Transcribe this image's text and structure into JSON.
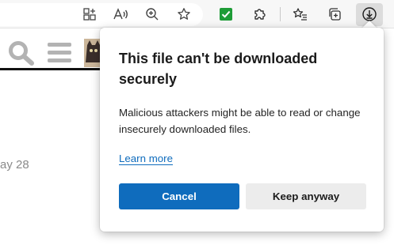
{
  "toolbar": {
    "icons": [
      "app-grid-icon",
      "read-aloud-icon",
      "zoom-icon",
      "favorite-star-icon",
      "checkbox-extension-icon",
      "extensions-puzzle-icon",
      "favorites-list-icon",
      "collections-icon",
      "download-icon"
    ],
    "accent": "#0f6cbd",
    "extension_green": "#1e9c37"
  },
  "page": {
    "date_fragment": "ay 28"
  },
  "dialog": {
    "title": "This file can't be downloaded securely",
    "body": "Malicious attackers might be able to read or change insecurely downloaded files.",
    "link": "Learn more",
    "primary_button": "Cancel",
    "secondary_button": "Keep anyway"
  }
}
